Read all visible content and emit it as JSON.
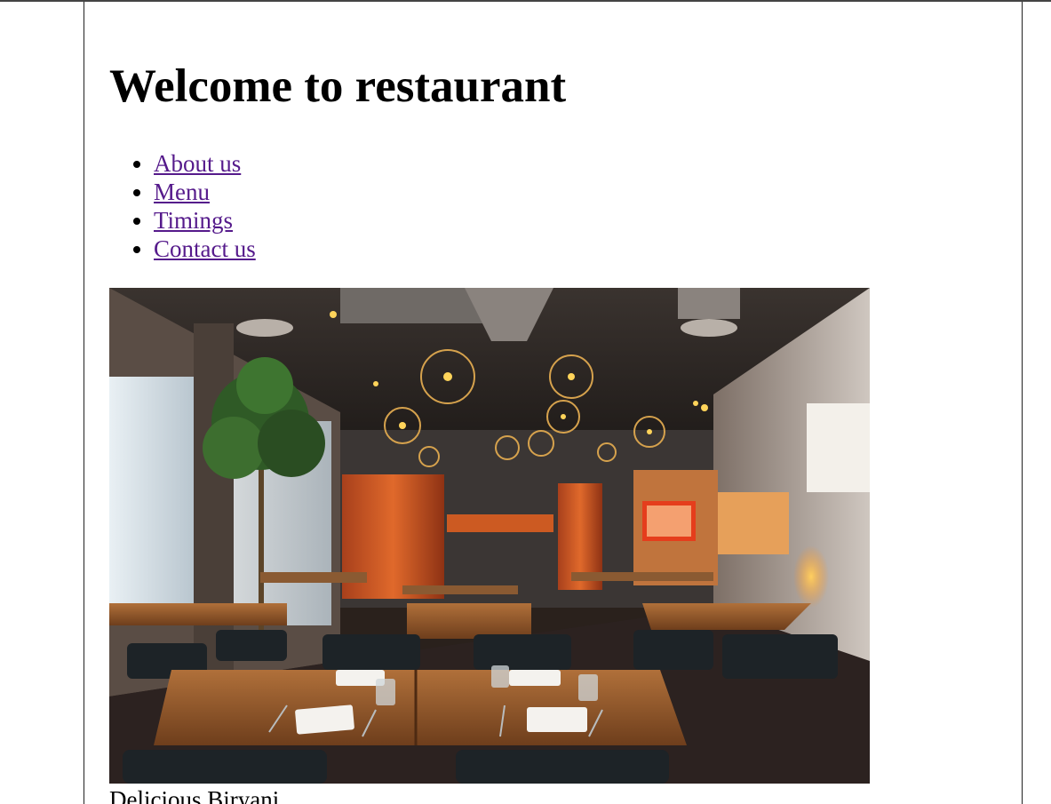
{
  "page": {
    "heading": "Welcome to restaurant"
  },
  "nav": {
    "items": [
      {
        "label": "About us"
      },
      {
        "label": "Menu"
      },
      {
        "label": "Timings"
      },
      {
        "label": "Contact us"
      }
    ]
  },
  "hero": {
    "alt": "Restaurant interior"
  },
  "caption": {
    "text": "Delicious Biryani"
  },
  "colors": {
    "link_visited": "#551a8b",
    "text": "#000000",
    "background": "#ffffff"
  }
}
